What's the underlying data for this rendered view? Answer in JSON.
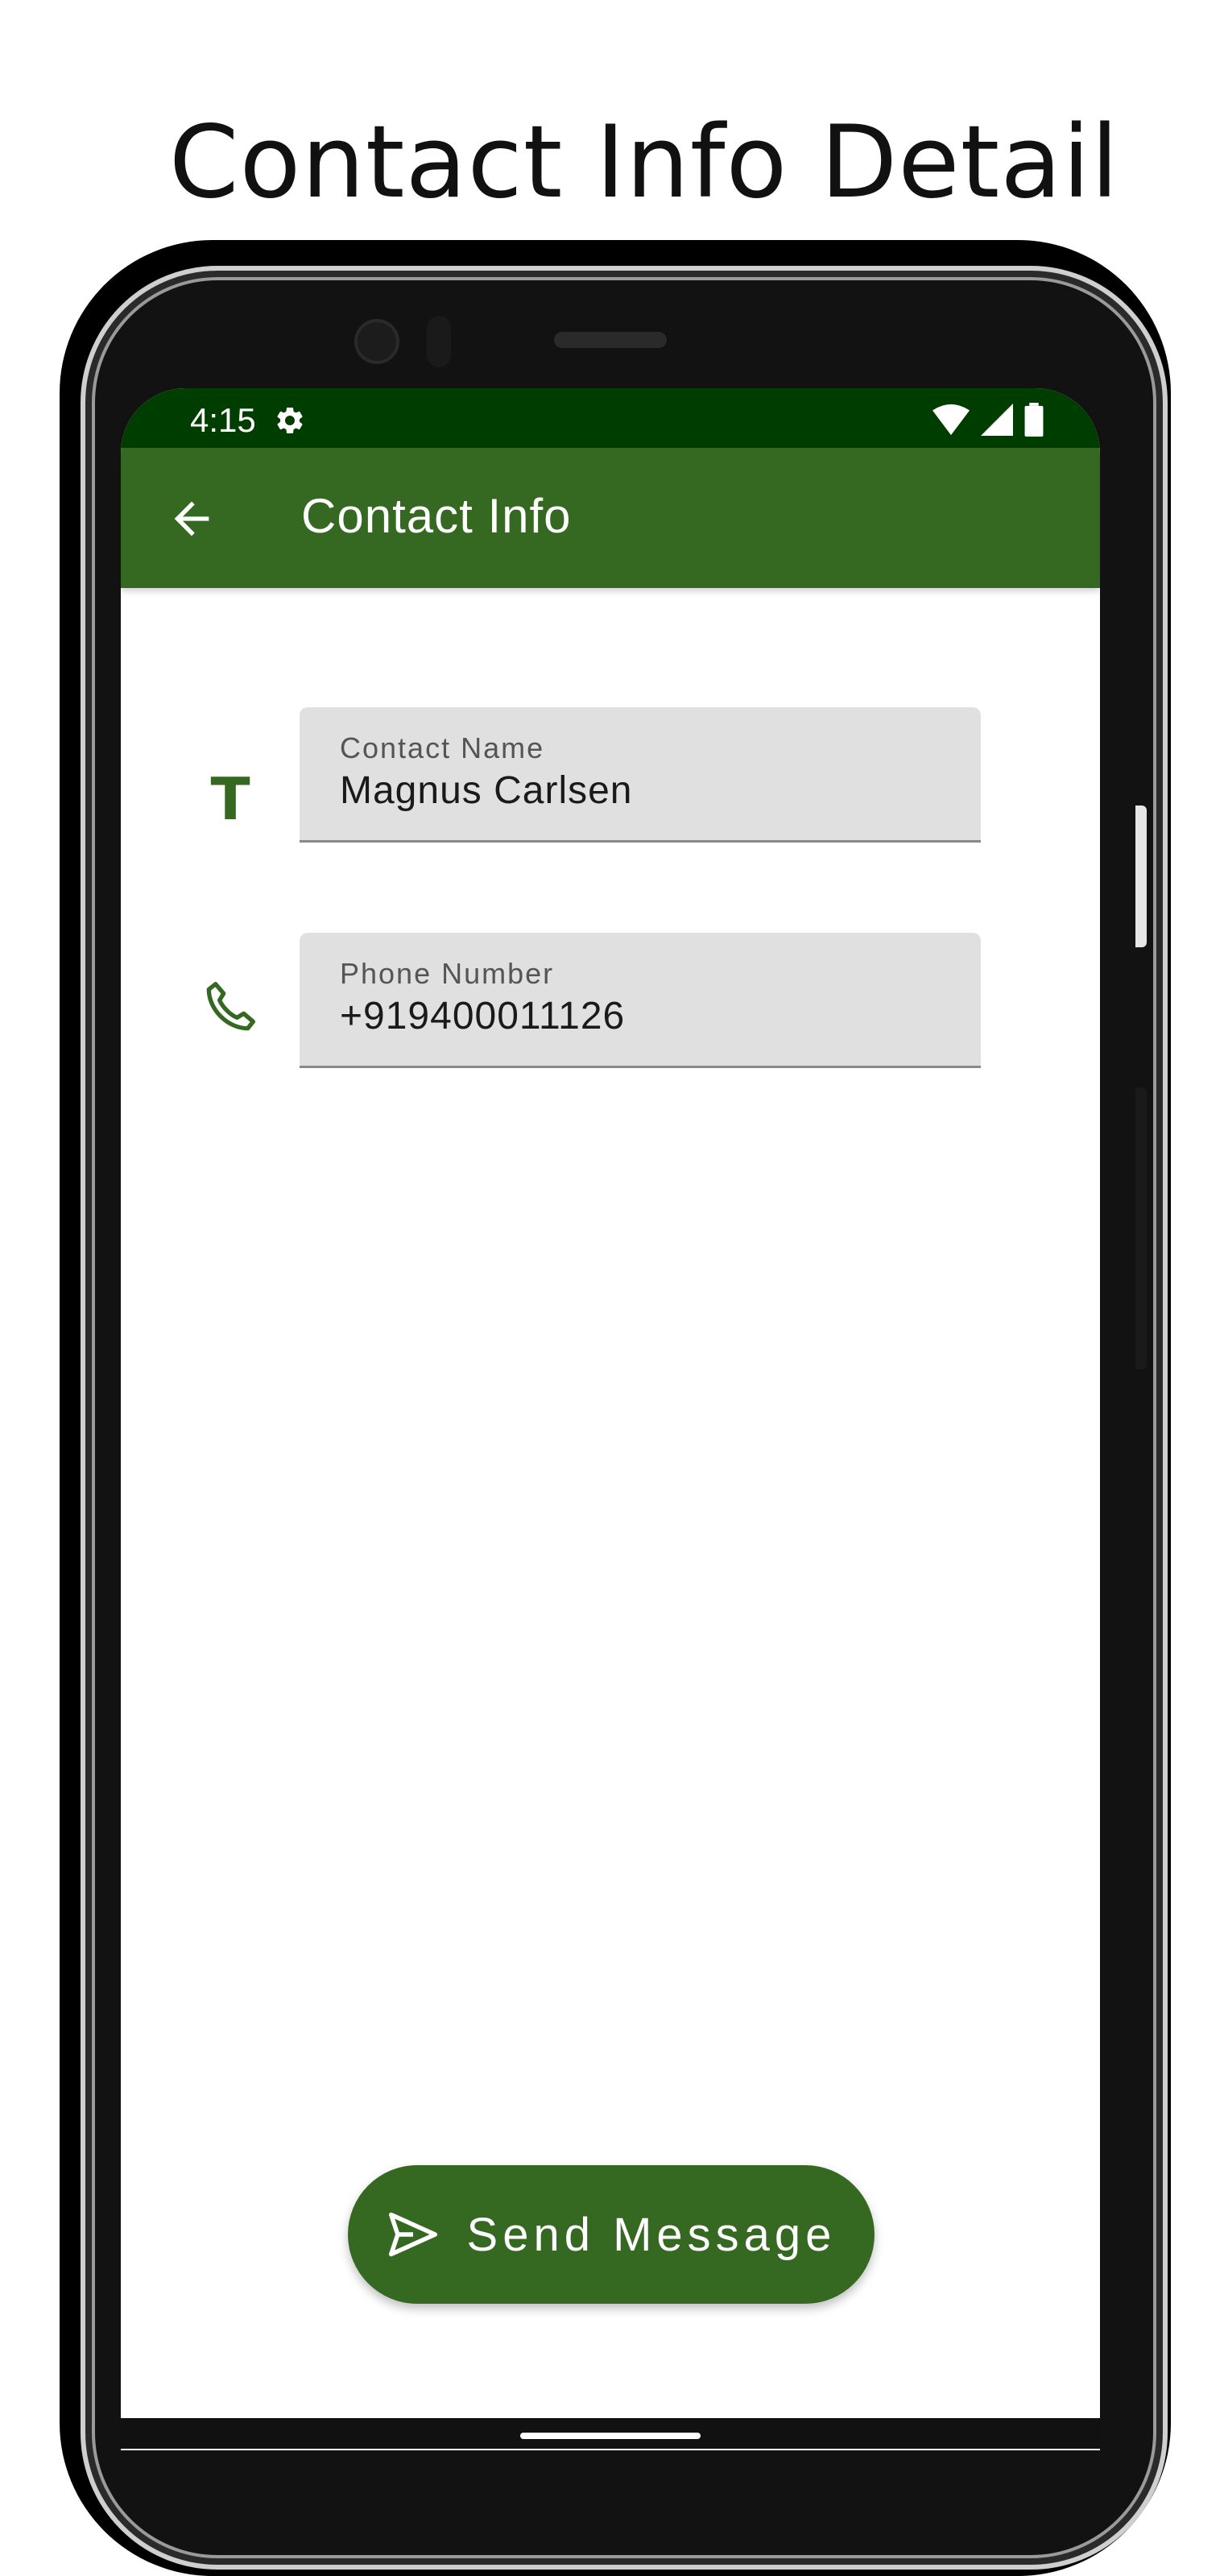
{
  "headline": "Contact Info Detail",
  "status_bar": {
    "time": "4:15",
    "icons": [
      "gear-icon",
      "wifi-icon",
      "signal-icon",
      "battery-icon"
    ]
  },
  "app_bar": {
    "title": "Contact Info",
    "back_icon": "arrow-left-icon"
  },
  "fields": {
    "contact_name": {
      "label": "Contact Name",
      "value": "Magnus Carlsen",
      "icon": "T"
    },
    "phone_number": {
      "label": "Phone Number",
      "value": "+919400011126",
      "icon": "phone-icon"
    }
  },
  "send_button": {
    "label": "Send Message",
    "icon": "send-icon"
  },
  "colors": {
    "app_bar": "#356820",
    "status_bar": "#003d00",
    "accent": "#356820",
    "field_background": "#e0e0e0"
  }
}
